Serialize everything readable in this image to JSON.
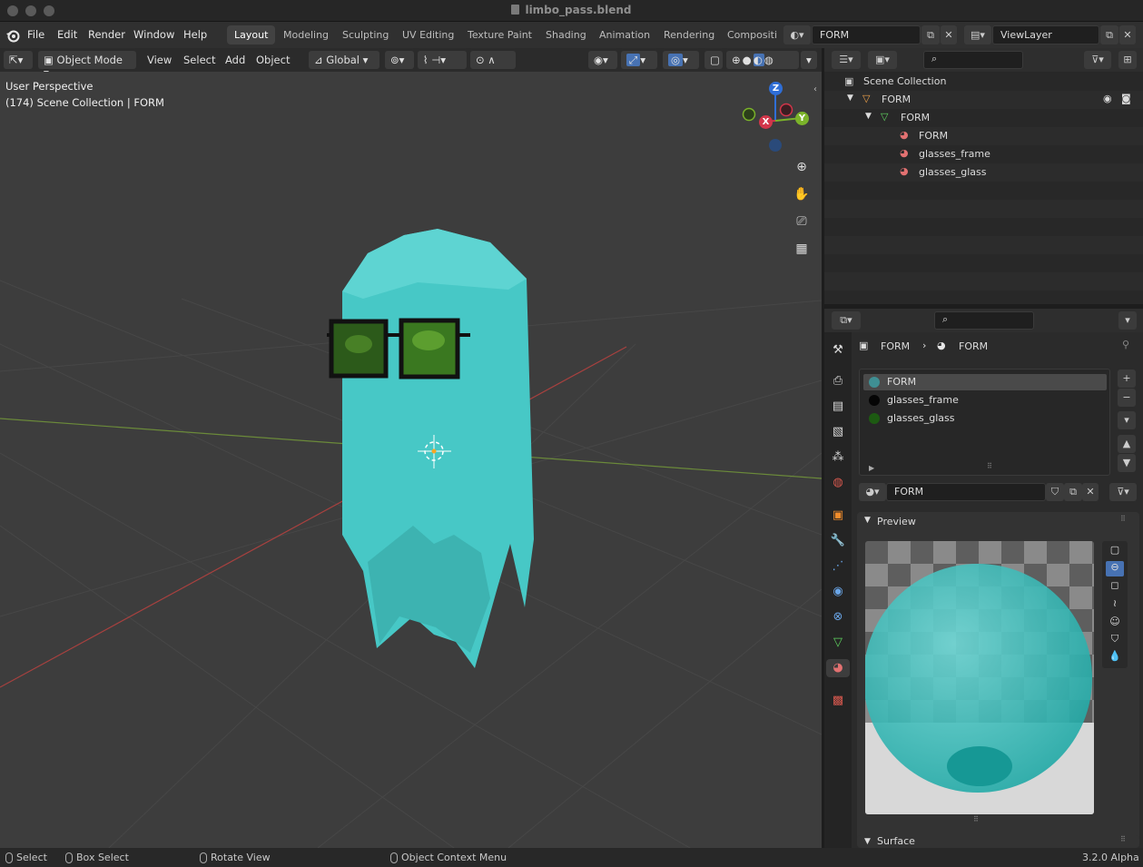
{
  "window": {
    "title": "limbo_pass.blend"
  },
  "menu": [
    "File",
    "Edit",
    "Render",
    "Window",
    "Help"
  ],
  "workspaces": [
    "Layout",
    "Modeling",
    "Sculpting",
    "UV Editing",
    "Texture Paint",
    "Shading",
    "Animation",
    "Rendering",
    "Compositir"
  ],
  "active_workspace": "Layout",
  "scene_field": "FORM",
  "view_layer_field": "ViewLayer",
  "viewport_header": {
    "mode": "Object Mode",
    "view": "View",
    "select": "Select",
    "add": "Add",
    "object": "Object",
    "orientation": "Global"
  },
  "viewport": {
    "perspective": "User Perspective",
    "context": "(174) Scene Collection | FORM"
  },
  "gizmo": {
    "z": "Z",
    "x": "X",
    "y": "Y"
  },
  "outliner": {
    "root": "Scene Collection",
    "rows": [
      {
        "label": "FORM",
        "indent": 1,
        "icon": "collection-icon"
      },
      {
        "label": "FORM",
        "indent": 2,
        "icon": "mesh-data-icon"
      },
      {
        "label": "FORM",
        "indent": 3,
        "icon": "material-icon"
      },
      {
        "label": "glasses_frame",
        "indent": 3,
        "icon": "material-icon"
      },
      {
        "label": "glasses_glass",
        "indent": 3,
        "icon": "material-icon"
      }
    ]
  },
  "properties": {
    "breadcrumb_object": "FORM",
    "breadcrumb_material": "FORM",
    "slots": [
      {
        "name": "FORM",
        "color": "#3f8f93"
      },
      {
        "name": "glasses_frame",
        "color": "#050505"
      },
      {
        "name": "glasses_glass",
        "color": "#1d5a12"
      }
    ],
    "material_name": "FORM",
    "preview_label": "Preview",
    "surface_label": "Surface"
  },
  "statusbar": {
    "select": "Select",
    "box_select": "Box Select",
    "rotate": "Rotate View",
    "context_menu": "Object Context Menu",
    "version": "3.2.0 Alpha"
  }
}
